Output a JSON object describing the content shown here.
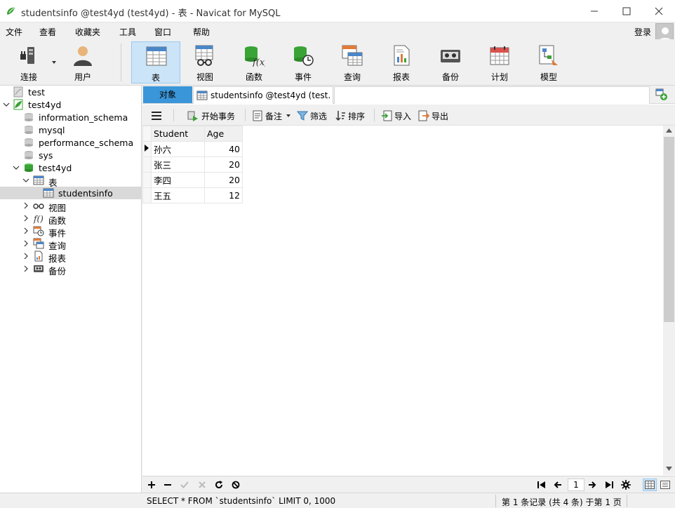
{
  "window": {
    "title": "studentsinfo @test4yd (test4yd) - 表 - Navicat for MySQL"
  },
  "menu": {
    "items": [
      "文件",
      "查看",
      "收藏夹",
      "工具",
      "窗口",
      "帮助"
    ],
    "login": "登录"
  },
  "toolbar": {
    "items": [
      {
        "label": "连接",
        "icon": "connection-icon"
      },
      {
        "label": "用户",
        "icon": "user-icon"
      },
      {
        "label": "表",
        "icon": "table-icon",
        "active": true
      },
      {
        "label": "视图",
        "icon": "view-icon"
      },
      {
        "label": "函数",
        "icon": "function-icon"
      },
      {
        "label": "事件",
        "icon": "event-icon"
      },
      {
        "label": "查询",
        "icon": "query-icon"
      },
      {
        "label": "报表",
        "icon": "report-icon"
      },
      {
        "label": "备份",
        "icon": "backup-icon"
      },
      {
        "label": "计划",
        "icon": "schedule-icon"
      },
      {
        "label": "模型",
        "icon": "model-icon"
      }
    ]
  },
  "sidebar": {
    "items": [
      {
        "label": "test"
      },
      {
        "label": "test4yd"
      },
      {
        "label": "information_schema"
      },
      {
        "label": "mysql"
      },
      {
        "label": "performance_schema"
      },
      {
        "label": "sys"
      },
      {
        "label": "test4yd"
      },
      {
        "label": "表"
      },
      {
        "label": "studentsinfo"
      },
      {
        "label": "视图"
      },
      {
        "label": "函数"
      },
      {
        "label": "事件"
      },
      {
        "label": "查询"
      },
      {
        "label": "报表"
      },
      {
        "label": "备份"
      }
    ]
  },
  "tabs": {
    "objects": "对象",
    "table_tab": "studentsinfo @test4yd (test..."
  },
  "grid_toolbar": {
    "begin_transaction": "开始事务",
    "note": "备注",
    "filter": "筛选",
    "sort": "排序",
    "import": "导入",
    "export": "导出"
  },
  "grid": {
    "columns": [
      "Student",
      "Age"
    ],
    "rows": [
      [
        "孙六",
        "40"
      ],
      [
        "张三",
        "20"
      ],
      [
        "李四",
        "20"
      ],
      [
        "王五",
        "12"
      ]
    ]
  },
  "pagination": {
    "page": "1"
  },
  "status": {
    "sql": "SELECT * FROM `studentsinfo` LIMIT 0, 1000",
    "records": "第 1 条记录 (共 4 条) 于第 1 页"
  },
  "colors": {
    "accent": "#3b96d9",
    "active_tool": "#cce4f7",
    "db_green": "#3aa335"
  }
}
